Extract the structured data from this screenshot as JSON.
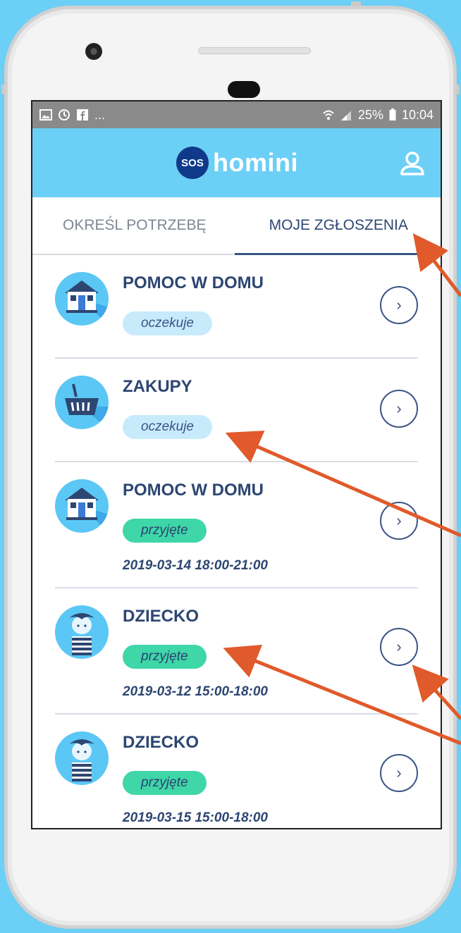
{
  "statusbar": {
    "left_icons": [
      "image-icon",
      "sync-icon",
      "facebook-icon"
    ],
    "dots": "...",
    "battery": "25%",
    "time": "10:04"
  },
  "appbar": {
    "logo_badge": "SOS",
    "logo_text": "homini"
  },
  "tabs": [
    {
      "label": "OKREŚL POTRZEBĘ",
      "active": false
    },
    {
      "label": "MOJE ZGŁOSZENIA",
      "active": true
    }
  ],
  "requests": [
    {
      "title": "POMOC W DOMU",
      "status": "oczekuje",
      "status_type": "wait",
      "date": "",
      "icon": "house-icon"
    },
    {
      "title": "ZAKUPY",
      "status": "oczekuje",
      "status_type": "wait",
      "date": "",
      "icon": "basket-icon"
    },
    {
      "title": "POMOC W DOMU",
      "status": "przyjęte",
      "status_type": "ok",
      "date": "2019-03-14 18:00-21:00",
      "icon": "house-icon"
    },
    {
      "title": "DZIECKO",
      "status": "przyjęte",
      "status_type": "ok",
      "date": "2019-03-12 15:00-18:00",
      "icon": "child-icon"
    },
    {
      "title": "DZIECKO",
      "status": "przyjęte",
      "status_type": "ok",
      "date": "2019-03-15 15:00-18:00",
      "icon": "child-icon"
    }
  ],
  "colors": {
    "background": "#6ccff6",
    "primary": "#2d4672",
    "pending_badge": "#c8ebfb",
    "accepted_badge": "#3fd6a8",
    "annotation_arrow": "#e05a2b"
  }
}
